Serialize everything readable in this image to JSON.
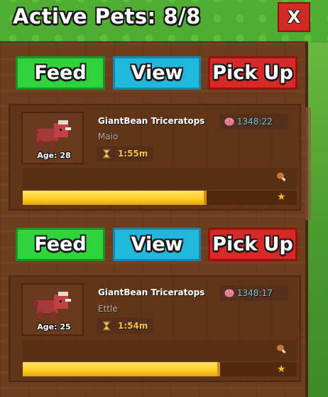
{
  "header": {
    "title": "Active Pets: 8/8",
    "close_label": "X"
  },
  "actions": {
    "feed": "Feed",
    "view": "View",
    "pick_up": "Pick Up"
  },
  "pets": [
    {
      "species": "GiantBean Triceratops",
      "nickname": "Maio",
      "age_label": "Age: 28",
      "timer": "1:55m",
      "bits": "1348:22",
      "growth_fraction": 0.67
    },
    {
      "species": "GiantBean Triceratops",
      "nickname": "Ettle",
      "age_label": "Age: 25",
      "timer": "1:54m",
      "bits": "1348:17",
      "growth_fraction": 0.72
    }
  ],
  "icons": {
    "brain": "brain-icon",
    "hourglass": "hourglass-icon",
    "drumstick": "drumstick-icon",
    "star": "star-icon"
  },
  "colors": {
    "feed": "#2fd33a",
    "view": "#22b7dc",
    "pick_up": "#d72a26",
    "close": "#d42a24",
    "progress": "#ffcf24"
  }
}
